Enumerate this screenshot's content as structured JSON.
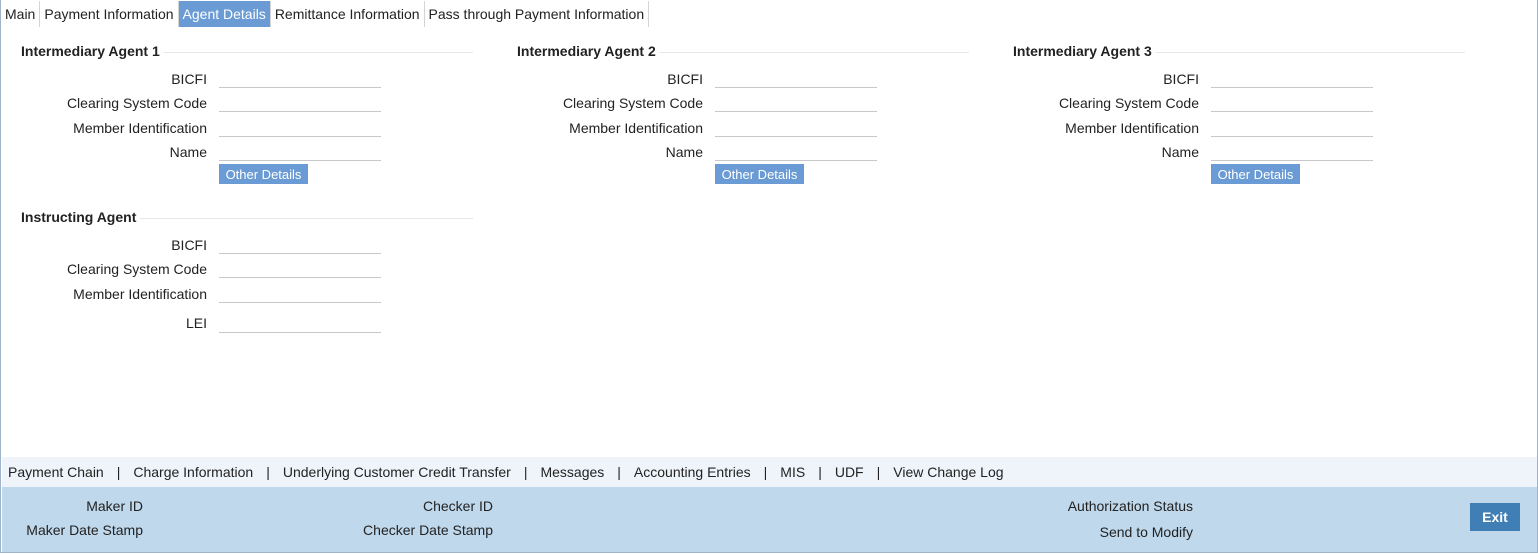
{
  "tabs": [
    {
      "label": "Main"
    },
    {
      "label": "Payment Information"
    },
    {
      "label": "Agent Details"
    },
    {
      "label": "Remittance Information"
    },
    {
      "label": "Pass through Payment Information"
    }
  ],
  "intermediary_agent_1": {
    "title": "Intermediary Agent 1",
    "bicfi": "BICFI",
    "clearing_system_code": "Clearing System Code",
    "member_identification": "Member Identification",
    "name": "Name",
    "other_details": "Other Details"
  },
  "intermediary_agent_2": {
    "title": "Intermediary Agent 2",
    "bicfi": "BICFI",
    "clearing_system_code": "Clearing System Code",
    "member_identification": "Member Identification",
    "name": "Name",
    "other_details": "Other Details"
  },
  "intermediary_agent_3": {
    "title": "Intermediary Agent 3",
    "bicfi": "BICFI",
    "clearing_system_code": "Clearing System Code",
    "member_identification": "Member Identification",
    "name": "Name",
    "other_details": "Other Details"
  },
  "instructing_agent": {
    "title": "Instructing Agent",
    "bicfi": "BICFI",
    "clearing_system_code": "Clearing System Code",
    "member_identification": "Member Identification",
    "lei": "LEI"
  },
  "footer_links": [
    {
      "label": "Payment Chain"
    },
    {
      "label": "Charge Information"
    },
    {
      "label": "Underlying Customer Credit Transfer"
    },
    {
      "label": "Messages"
    },
    {
      "label": "Accounting Entries"
    },
    {
      "label": "MIS"
    },
    {
      "label": "UDF"
    },
    {
      "label": "View Change Log"
    }
  ],
  "link_separator": "|",
  "audit": {
    "maker_id": "Maker ID",
    "maker_date_stamp": "Maker Date Stamp",
    "checker_id": "Checker ID",
    "checker_date_stamp": "Checker Date Stamp",
    "authorization_status": "Authorization Status",
    "send_to_modify": "Send to Modify",
    "exit": "Exit"
  },
  "colors": {
    "active_tab": "#6a9bd4",
    "button": "#6a9bd4",
    "audit_bar": "#bfd8ec",
    "link_bar": "#eef4fa",
    "exit_button": "#3f7fb6"
  }
}
